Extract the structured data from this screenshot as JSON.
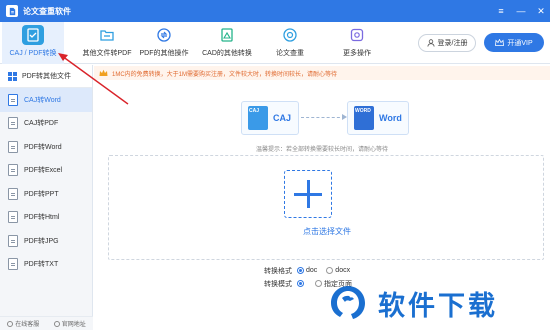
{
  "app": {
    "title": "论文查重软件"
  },
  "toolbar": {
    "tools": [
      {
        "label": "CAJ / PDF转换",
        "icon": "caj-pdf-convert-icon",
        "color": "#2f9fe0"
      },
      {
        "label": "其他文件转PDF",
        "icon": "folder-icon",
        "color": "#2f9fe0"
      },
      {
        "label": "PDF的其他操作",
        "icon": "pdf-ops-icon",
        "color": "#2f78e4"
      },
      {
        "label": "CAD的其他转换",
        "icon": "cad-icon",
        "color": "#24b38a"
      },
      {
        "label": "论文查重",
        "icon": "check-icon",
        "color": "#2f9fe0"
      },
      {
        "label": "更多操作",
        "icon": "gear-icon",
        "color": "#7b6be0"
      }
    ],
    "login_label": "登录/注册",
    "vip_label": "开通VIP"
  },
  "sidebar": {
    "head": "PDF转其他文件",
    "items": [
      "CAJ转Word",
      "CAJ转PDF",
      "PDF转Word",
      "PDF转Excel",
      "PDF转PPT",
      "PDF转Html",
      "PDF转JPG",
      "PDF转TXT"
    ],
    "active_index": 0,
    "footer_left": "在线客服",
    "footer_right": "官网地址"
  },
  "notice": {
    "text": "1MC内的免费转换，大于1M需要购买注册，文件较大时，转换时间较长，请耐心等待"
  },
  "flow": {
    "from": "CAJ",
    "from_tag": "CAJ",
    "to": "Word",
    "to_tag": "WORD"
  },
  "main": {
    "hint": "温馨提示：若全部转换需要较长时间，请耐心等待",
    "select_label": "点击选择文件",
    "format_key": "转换格式",
    "format_options": [
      "doc",
      "docx"
    ],
    "mode_key": "转换模式",
    "mode_options": [
      "",
      "指定页面"
    ]
  },
  "brand": {
    "text": "软件下载"
  },
  "colors": {
    "accent": "#2f78e4",
    "annotation": "#d9232a",
    "notice": "#e06a30"
  }
}
